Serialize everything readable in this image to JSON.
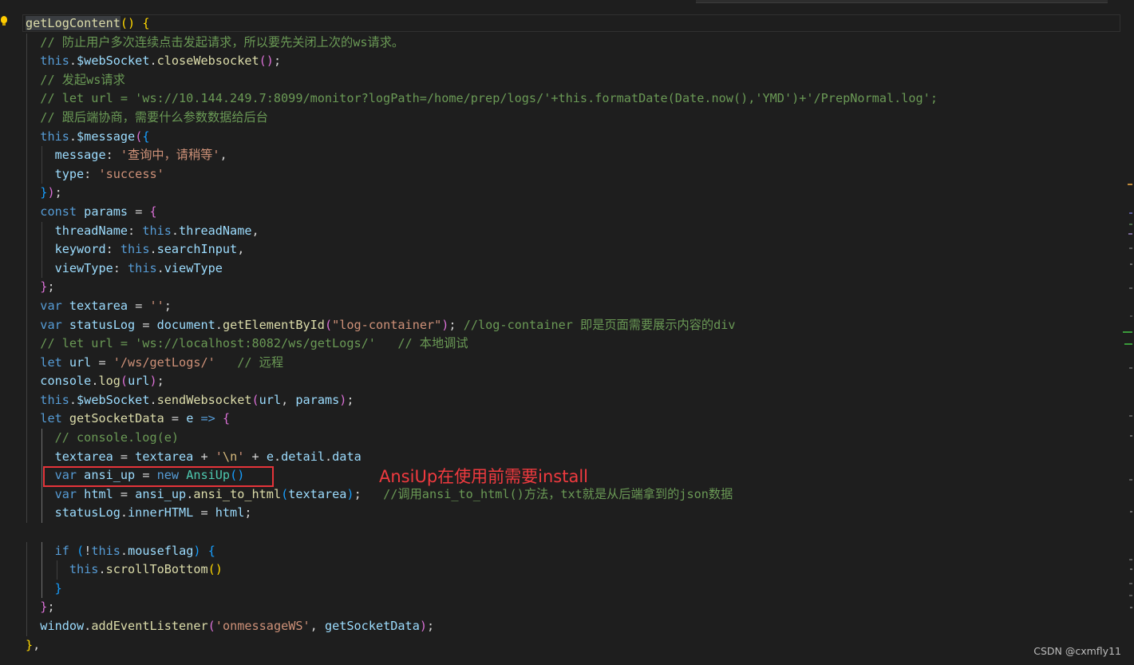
{
  "editor": {
    "language": "javascript",
    "lines": [
      [
        [
          "fn hl",
          "getLogContent"
        ],
        [
          "b1",
          "()"
        ],
        [
          "pl",
          " "
        ],
        [
          "b1",
          "{"
        ]
      ],
      [
        [
          "pl",
          "  "
        ],
        [
          "cmt",
          "// 防止用户多次连续点击发起请求，所以要先关闭上次的ws请求。"
        ]
      ],
      [
        [
          "pl",
          "  "
        ],
        [
          "kw",
          "this"
        ],
        [
          "pl",
          "."
        ],
        [
          "var",
          "$webSocket"
        ],
        [
          "pl",
          "."
        ],
        [
          "fn",
          "closeWebsocket"
        ],
        [
          "b2",
          "()"
        ],
        [
          "pl",
          ";"
        ]
      ],
      [
        [
          "pl",
          "  "
        ],
        [
          "cmt",
          "// 发起ws请求"
        ]
      ],
      [
        [
          "pl",
          "  "
        ],
        [
          "cmt",
          "// let url = 'ws://10.144.249.7:8099/monitor?logPath=/home/prep/logs/'+this.formatDate(Date.now(),'YMD')+'/PrepNormal.log';"
        ]
      ],
      [
        [
          "pl",
          "  "
        ],
        [
          "cmt",
          "// 跟后端协商，需要什么参数数据给后台"
        ]
      ],
      [
        [
          "pl",
          "  "
        ],
        [
          "kw",
          "this"
        ],
        [
          "pl",
          "."
        ],
        [
          "var",
          "$message"
        ],
        [
          "b2",
          "("
        ],
        [
          "b3",
          "{"
        ]
      ],
      [
        [
          "pl",
          "    "
        ],
        [
          "prop",
          "message"
        ],
        [
          "pl",
          ": "
        ],
        [
          "str",
          "'查询中，请稍等'"
        ],
        [
          "pl",
          ","
        ]
      ],
      [
        [
          "pl",
          "    "
        ],
        [
          "prop",
          "type"
        ],
        [
          "pl",
          ": "
        ],
        [
          "str",
          "'success'"
        ]
      ],
      [
        [
          "pl",
          "  "
        ],
        [
          "b3",
          "}"
        ],
        [
          "b2",
          ")"
        ],
        [
          "pl",
          ";"
        ]
      ],
      [
        [
          "pl",
          "  "
        ],
        [
          "kw",
          "const"
        ],
        [
          "pl",
          " "
        ],
        [
          "var",
          "params"
        ],
        [
          "pl",
          " = "
        ],
        [
          "b2",
          "{"
        ]
      ],
      [
        [
          "pl",
          "    "
        ],
        [
          "prop",
          "threadName"
        ],
        [
          "pl",
          ": "
        ],
        [
          "kw",
          "this"
        ],
        [
          "pl",
          "."
        ],
        [
          "var",
          "threadName"
        ],
        [
          "pl",
          ","
        ]
      ],
      [
        [
          "pl",
          "    "
        ],
        [
          "prop",
          "keyword"
        ],
        [
          "pl",
          ": "
        ],
        [
          "kw",
          "this"
        ],
        [
          "pl",
          "."
        ],
        [
          "var",
          "searchInput"
        ],
        [
          "pl",
          ","
        ]
      ],
      [
        [
          "pl",
          "    "
        ],
        [
          "prop",
          "viewType"
        ],
        [
          "pl",
          ": "
        ],
        [
          "kw",
          "this"
        ],
        [
          "pl",
          "."
        ],
        [
          "var",
          "viewType"
        ]
      ],
      [
        [
          "pl",
          "  "
        ],
        [
          "b2",
          "}"
        ],
        [
          "pl",
          ";"
        ]
      ],
      [
        [
          "pl",
          "  "
        ],
        [
          "kw",
          "var"
        ],
        [
          "pl",
          " "
        ],
        [
          "var",
          "textarea"
        ],
        [
          "pl",
          " = "
        ],
        [
          "str",
          "''"
        ],
        [
          "pl",
          ";"
        ]
      ],
      [
        [
          "pl",
          "  "
        ],
        [
          "kw",
          "var"
        ],
        [
          "pl",
          " "
        ],
        [
          "var",
          "statusLog"
        ],
        [
          "pl",
          " = "
        ],
        [
          "var",
          "document"
        ],
        [
          "pl",
          "."
        ],
        [
          "fn",
          "getElementById"
        ],
        [
          "b2",
          "("
        ],
        [
          "str",
          "\"log-container\""
        ],
        [
          "b2",
          ")"
        ],
        [
          "pl",
          "; "
        ],
        [
          "cmt",
          "//log-container 即是页面需要展示内容的div"
        ]
      ],
      [
        [
          "pl",
          "  "
        ],
        [
          "cmt",
          "// let url = 'ws://localhost:8082/ws/getLogs/'   // 本地调试"
        ]
      ],
      [
        [
          "pl",
          "  "
        ],
        [
          "kw",
          "let"
        ],
        [
          "pl",
          " "
        ],
        [
          "var",
          "url"
        ],
        [
          "pl",
          " = "
        ],
        [
          "str",
          "'/ws/getLogs/'"
        ],
        [
          "pl",
          "   "
        ],
        [
          "cmt",
          "// 远程"
        ]
      ],
      [
        [
          "pl",
          "  "
        ],
        [
          "var",
          "console"
        ],
        [
          "pl",
          "."
        ],
        [
          "fn",
          "log"
        ],
        [
          "b2",
          "("
        ],
        [
          "var",
          "url"
        ],
        [
          "b2",
          ")"
        ],
        [
          "pl",
          ";"
        ]
      ],
      [
        [
          "pl",
          "  "
        ],
        [
          "kw",
          "this"
        ],
        [
          "pl",
          "."
        ],
        [
          "var",
          "$webSocket"
        ],
        [
          "pl",
          "."
        ],
        [
          "fn",
          "sendWebsocket"
        ],
        [
          "b2",
          "("
        ],
        [
          "var",
          "url"
        ],
        [
          "pl",
          ", "
        ],
        [
          "var",
          "params"
        ],
        [
          "b2",
          ")"
        ],
        [
          "pl",
          ";"
        ]
      ],
      [
        [
          "pl",
          "  "
        ],
        [
          "kw",
          "let"
        ],
        [
          "pl",
          " "
        ],
        [
          "fn",
          "getSocketData"
        ],
        [
          "pl",
          " = "
        ],
        [
          "var",
          "e"
        ],
        [
          "pl",
          " "
        ],
        [
          "kw",
          "=>"
        ],
        [
          "pl",
          " "
        ],
        [
          "b2",
          "{"
        ]
      ],
      [
        [
          "pl",
          "    "
        ],
        [
          "cmt",
          "// console.log(e)"
        ]
      ],
      [
        [
          "pl",
          "    "
        ],
        [
          "var",
          "textarea"
        ],
        [
          "pl",
          " = "
        ],
        [
          "var",
          "textarea"
        ],
        [
          "pl",
          " + "
        ],
        [
          "str",
          "'"
        ],
        [
          "esc",
          "\\n"
        ],
        [
          "str",
          "'"
        ],
        [
          "pl",
          " + "
        ],
        [
          "var",
          "e"
        ],
        [
          "pl",
          "."
        ],
        [
          "var",
          "detail"
        ],
        [
          "pl",
          "."
        ],
        [
          "var",
          "data"
        ]
      ],
      [
        [
          "pl",
          "    "
        ],
        [
          "kw",
          "var"
        ],
        [
          "pl",
          " "
        ],
        [
          "var",
          "ansi_up"
        ],
        [
          "pl",
          " = "
        ],
        [
          "kw",
          "new"
        ],
        [
          "pl",
          " "
        ],
        [
          "cls",
          "AnsiUp"
        ],
        [
          "b3",
          "()"
        ]
      ],
      [
        [
          "pl",
          "    "
        ],
        [
          "kw",
          "var"
        ],
        [
          "pl",
          " "
        ],
        [
          "var",
          "html"
        ],
        [
          "pl",
          " = "
        ],
        [
          "var",
          "ansi_up"
        ],
        [
          "pl",
          "."
        ],
        [
          "fn",
          "ansi_to_html"
        ],
        [
          "b3",
          "("
        ],
        [
          "var",
          "textarea"
        ],
        [
          "b3",
          ")"
        ],
        [
          "pl",
          ";   "
        ],
        [
          "cmt",
          "//调用ansi_to_html()方法，txt就是从后端拿到的json数据"
        ]
      ],
      [
        [
          "pl",
          "    "
        ],
        [
          "var",
          "statusLog"
        ],
        [
          "pl",
          "."
        ],
        [
          "var",
          "innerHTML"
        ],
        [
          "pl",
          " = "
        ],
        [
          "var",
          "html"
        ],
        [
          "pl",
          ";"
        ]
      ],
      [
        [
          "pl",
          ""
        ]
      ],
      [
        [
          "pl",
          "    "
        ],
        [
          "kw",
          "if"
        ],
        [
          "pl",
          " "
        ],
        [
          "b3",
          "("
        ],
        [
          "pl",
          "!"
        ],
        [
          "kw",
          "this"
        ],
        [
          "pl",
          "."
        ],
        [
          "var",
          "mouseflag"
        ],
        [
          "b3",
          ")"
        ],
        [
          "pl",
          " "
        ],
        [
          "b3",
          "{"
        ]
      ],
      [
        [
          "pl",
          "      "
        ],
        [
          "kw",
          "this"
        ],
        [
          "pl",
          "."
        ],
        [
          "fn",
          "scrollToBottom"
        ],
        [
          "b1",
          "()"
        ]
      ],
      [
        [
          "pl",
          "    "
        ],
        [
          "b3",
          "}"
        ]
      ],
      [
        [
          "pl",
          "  "
        ],
        [
          "b2",
          "}"
        ],
        [
          "pl",
          ";"
        ]
      ],
      [
        [
          "pl",
          "  "
        ],
        [
          "var",
          "window"
        ],
        [
          "pl",
          "."
        ],
        [
          "fn",
          "addEventListener"
        ],
        [
          "b2",
          "("
        ],
        [
          "str",
          "'onmessageWS'"
        ],
        [
          "pl",
          ", "
        ],
        [
          "var",
          "getSocketData"
        ],
        [
          "b2",
          ")"
        ],
        [
          "pl",
          ";"
        ]
      ],
      [
        [
          "b1",
          "}"
        ],
        [
          "pl",
          ","
        ]
      ]
    ]
  },
  "annotation": {
    "text": "AnsiUp在使用前需要install",
    "color": "#f03a3f"
  },
  "watermark": {
    "text": "CSDN @cxmfly11"
  },
  "icons": {
    "lightbulb": "lightbulb-icon"
  }
}
